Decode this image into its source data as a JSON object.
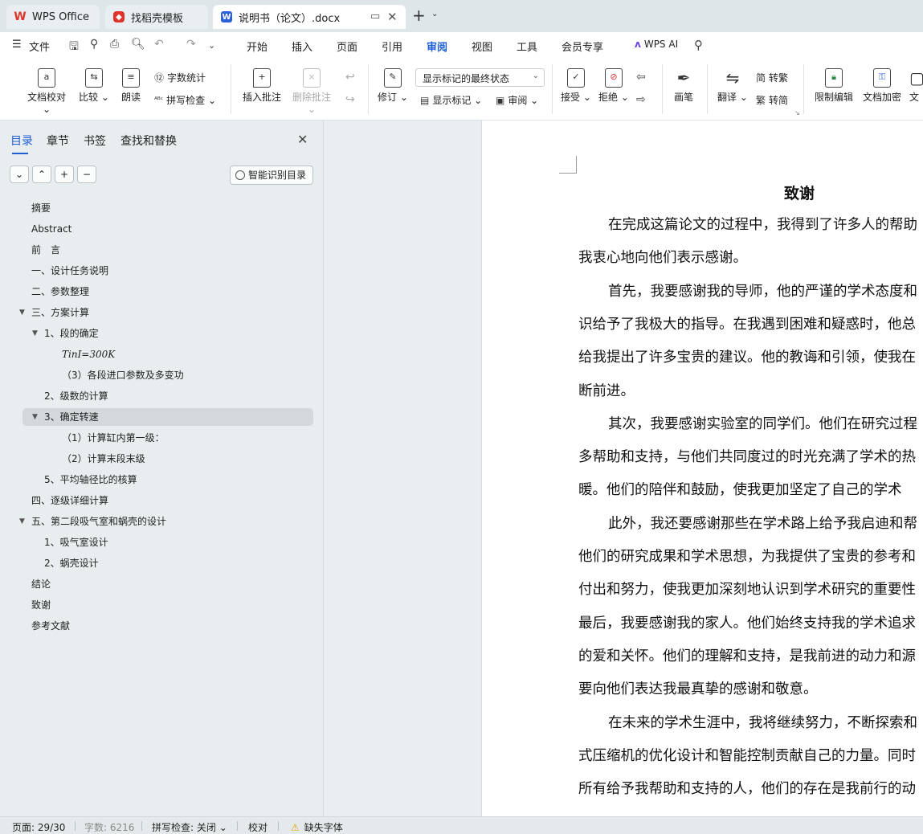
{
  "tabs": {
    "wps": "WPS Office",
    "template": "找稻壳模板",
    "doc": "说明书（论文）.docx"
  },
  "menu": {
    "file": "文件",
    "items": [
      "开始",
      "插入",
      "页面",
      "引用",
      "审阅",
      "视图",
      "工具",
      "会员专享"
    ],
    "active": "审阅",
    "ai": "WPS AI"
  },
  "ribbon": {
    "doc_proof": "文档校对",
    "compare": "比较",
    "read_aloud": "朗读",
    "word_count": "字数统计",
    "spell_check": "拼写检查",
    "insert_comment": "插入批注",
    "delete_comment": "删除批注",
    "track_changes": "修订",
    "markup_state": "显示标记的最终状态",
    "show_markup": "显示标记",
    "review": "审阅",
    "accept": "接受",
    "reject": "拒绝",
    "pen": "画笔",
    "translate": "翻译",
    "to_traditional": "转繁",
    "to_simplified": "转简",
    "restrict_edit": "限制编辑",
    "encrypt": "文档加密",
    "more": "文"
  },
  "nav": {
    "tabs": [
      "目录",
      "章节",
      "书签",
      "查找和替换"
    ],
    "smart_toc": "智能识别目录",
    "toc": [
      {
        "label": "摘要",
        "level": 1
      },
      {
        "label": "Abstract",
        "level": 1
      },
      {
        "label": "前　言",
        "level": 1
      },
      {
        "label": "一、设计任务说明",
        "level": 1
      },
      {
        "label": "二、参数整理",
        "level": 1
      },
      {
        "label": "三、方案计算",
        "level": 1,
        "expanded": true
      },
      {
        "label": "1、段的确定",
        "level": 2,
        "expanded": true
      },
      {
        "label": "TinI=300K",
        "level": 3,
        "math": true
      },
      {
        "label": "（3）各段进口参数及多变功",
        "level": 3
      },
      {
        "label": "2、级数的计算",
        "level": 2
      },
      {
        "label": "3、确定转速",
        "level": 2,
        "expanded": true,
        "selected": true
      },
      {
        "label": "（1）计算缸内第一级：",
        "level": 3
      },
      {
        "label": "（2）计算末段末级",
        "level": 3
      },
      {
        "label": "5、平均轴径比的核算",
        "level": 2
      },
      {
        "label": "四、逐级详细计算",
        "level": 1
      },
      {
        "label": "五、第二段吸气室和蜗壳的设计",
        "level": 1,
        "expanded": true
      },
      {
        "label": "1、吸气室设计",
        "level": 2
      },
      {
        "label": "2、蜗壳设计",
        "level": 2
      },
      {
        "label": "结论",
        "level": 1
      },
      {
        "label": "致谢",
        "level": 1
      },
      {
        "label": "参考文献",
        "level": 1
      }
    ]
  },
  "document": {
    "title": "致谢",
    "lines": [
      {
        "text": "在完成这篇论文的过程中，我得到了许多人的帮助",
        "indent": true
      },
      {
        "text": "我衷心地向他们表示感谢。",
        "indent": false
      },
      {
        "text": "首先，我要感谢我的导师，他的严谨的学术态度和",
        "indent": true
      },
      {
        "text": "识给予了我极大的指导。在我遇到困难和疑惑时，他总",
        "indent": false
      },
      {
        "text": "给我提出了许多宝贵的建议。他的教诲和引领，使我在",
        "indent": false
      },
      {
        "text": "断前进。",
        "indent": false
      },
      {
        "text": "其次，我要感谢实验室的同学们。他们在研究过程",
        "indent": true
      },
      {
        "text": "多帮助和支持，与他们共同度过的时光充满了学术的热",
        "indent": false
      },
      {
        "text": "暖。他们的陪伴和鼓励，使我更加坚定了自己的学术",
        "indent": false
      },
      {
        "text": "此外，我还要感谢那些在学术路上给予我启迪和帮",
        "indent": true
      },
      {
        "text": "他们的研究成果和学术思想，为我提供了宝贵的参考和",
        "indent": false
      },
      {
        "text": "付出和努力，使我更加深刻地认识到学术研究的重要性",
        "indent": false
      },
      {
        "text": "最后，我要感谢我的家人。他们始终支持我的学术追求",
        "indent": false
      },
      {
        "text": "的爱和关怀。他们的理解和支持，是我前进的动力和源",
        "indent": false
      },
      {
        "text": "要向他们表达我最真挚的感谢和敬意。",
        "indent": false
      },
      {
        "text": "在未来的学术生涯中，我将继续努力，不断探索和",
        "indent": true
      },
      {
        "text": "式压缩机的优化设计和智能控制贡献自己的力量。同时",
        "indent": false
      },
      {
        "text": "所有给予我帮助和支持的人，他们的存在是我前行的动",
        "indent": false
      }
    ]
  },
  "status": {
    "page": "页面: 29/30",
    "words": "字数: 6216",
    "spell": "拼写检查: 关闭",
    "proof": "校对",
    "missing_font": "缺失字体"
  }
}
